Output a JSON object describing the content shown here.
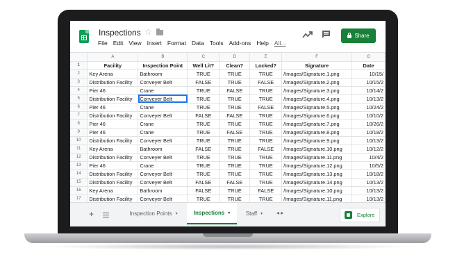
{
  "app": {
    "title": "Inspections",
    "star_glyph": "☆",
    "share_label": "Share",
    "accent_color": "#188038"
  },
  "menu": [
    "File",
    "Edit",
    "View",
    "Insert",
    "Format",
    "Data",
    "Tools",
    "Add-ons",
    "Help",
    "All..."
  ],
  "grid": {
    "column_letters": [
      "A",
      "B",
      "C",
      "D",
      "E",
      "F",
      "G"
    ],
    "header_row_number": "1",
    "headers": [
      "Facility",
      "Inspection Point",
      "Well Lit?",
      "Clean?",
      "Locked?",
      "Signature",
      "Date"
    ],
    "selected_cell": "B5",
    "rows": [
      {
        "n": "2",
        "cells": [
          "Key Arena",
          "Bathroom",
          "TRUE",
          "TRUE",
          "TRUE",
          "/Images/Signature.1.png",
          "10/15/"
        ]
      },
      {
        "n": "3",
        "cells": [
          "Distribution Facility",
          "Conveyer Belt",
          "FALSE",
          "TRUE",
          "FALSE",
          "/Images/Signature.2.png",
          "10/15/2"
        ]
      },
      {
        "n": "4",
        "cells": [
          "Pier 46",
          "Crane",
          "TRUE",
          "FALSE",
          "TRUE",
          "/Images/Signature.3.png",
          "10/14/2"
        ]
      },
      {
        "n": "5",
        "cells": [
          "Distribution Facility",
          "Conveyer Belt",
          "TRUE",
          "TRUE",
          "TRUE",
          "/Images/Signature.4.png",
          "10/13/2"
        ]
      },
      {
        "n": "6",
        "cells": [
          "Pier 46",
          "Crane",
          "TRUE",
          "TRUE",
          "FALSE",
          "/Images/Signature.5.png",
          "10/24/2"
        ]
      },
      {
        "n": "7",
        "cells": [
          "Distribution Facility",
          "Conveyer Belt",
          "FALSE",
          "FALSE",
          "TRUE",
          "/Images/Signature.6.png",
          "10/10/2"
        ]
      },
      {
        "n": "8",
        "cells": [
          "Pier 46",
          "Crane",
          "TRUE",
          "TRUE",
          "TRUE",
          "/Images/Signature.7.png",
          "10/26/2"
        ]
      },
      {
        "n": "9",
        "cells": [
          "Pier 46",
          "Crane",
          "TRUE",
          "FALSE",
          "TRUE",
          "/Images/Signature.8.png",
          "10/18/2"
        ]
      },
      {
        "n": "10",
        "cells": [
          "Distribution Facility",
          "Conveyer Belt",
          "TRUE",
          "TRUE",
          "TRUE",
          "/Images/Signature.9.png",
          "10/13/2"
        ]
      },
      {
        "n": "11",
        "cells": [
          "Key Arena",
          "Bathroom",
          "FALSE",
          "TRUE",
          "FALSE",
          "/Images/Signature.10.png",
          "10/12/2"
        ]
      },
      {
        "n": "12",
        "cells": [
          "Distribution Facility",
          "Conveyer Belt",
          "TRUE",
          "TRUE",
          "TRUE",
          "/Images/Signature.11.png",
          "10/4/2"
        ]
      },
      {
        "n": "13",
        "cells": [
          "Pier 46",
          "Crane",
          "TRUE",
          "TRUE",
          "TRUE",
          "/Images/Signature.12.png",
          "10/5/2"
        ]
      },
      {
        "n": "14",
        "cells": [
          "Distribution Facility",
          "Conveyer Belt",
          "TRUE",
          "TRUE",
          "TRUE",
          "/Images/Signature.13.png",
          "10/18/2"
        ]
      },
      {
        "n": "15",
        "cells": [
          "Distribution Facility",
          "Conveyer Belt",
          "FALSE",
          "FALSE",
          "TRUE",
          "/Images/Signature.14.png",
          "10/13/2"
        ]
      },
      {
        "n": "16",
        "cells": [
          "Key Arena",
          "Bathroom",
          "FALSE",
          "TRUE",
          "FALSE",
          "/Images/Signature.10.png",
          "10/13/2"
        ]
      },
      {
        "n": "17",
        "cells": [
          "Distribution Facility",
          "Conveyer Belt",
          "TRUE",
          "TRUE",
          "TRUE",
          "/Images/Signature.11.png",
          "10/13/2"
        ]
      }
    ]
  },
  "sheets": {
    "add_glyph": "+",
    "tabs": [
      {
        "label": "Inspection Points",
        "active": false
      },
      {
        "label": "Inspections",
        "active": true
      },
      {
        "label": "Staff",
        "active": false
      }
    ],
    "caret_glyph": "▾",
    "nav_glyph": "◂ ▸",
    "explore_label": "Explore"
  }
}
